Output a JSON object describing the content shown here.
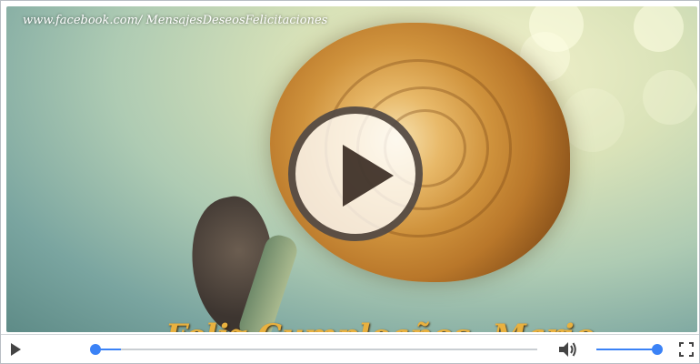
{
  "watermark": {
    "text": "www.facebook.com/ MensajesDeseosFelicitaciones"
  },
  "video": {
    "caption_text": "Feliz Cumpleaños, Mario"
  },
  "overlay": {
    "icon": "play-icon",
    "accent": "#2a1c14"
  },
  "controls": {
    "play_icon": "play-icon",
    "progress_fraction": 0.0,
    "volume_icon": "volume-icon",
    "volume_fraction": 1.0,
    "fullscreen_icon": "fullscreen-icon",
    "accent": "#3b82f6"
  }
}
